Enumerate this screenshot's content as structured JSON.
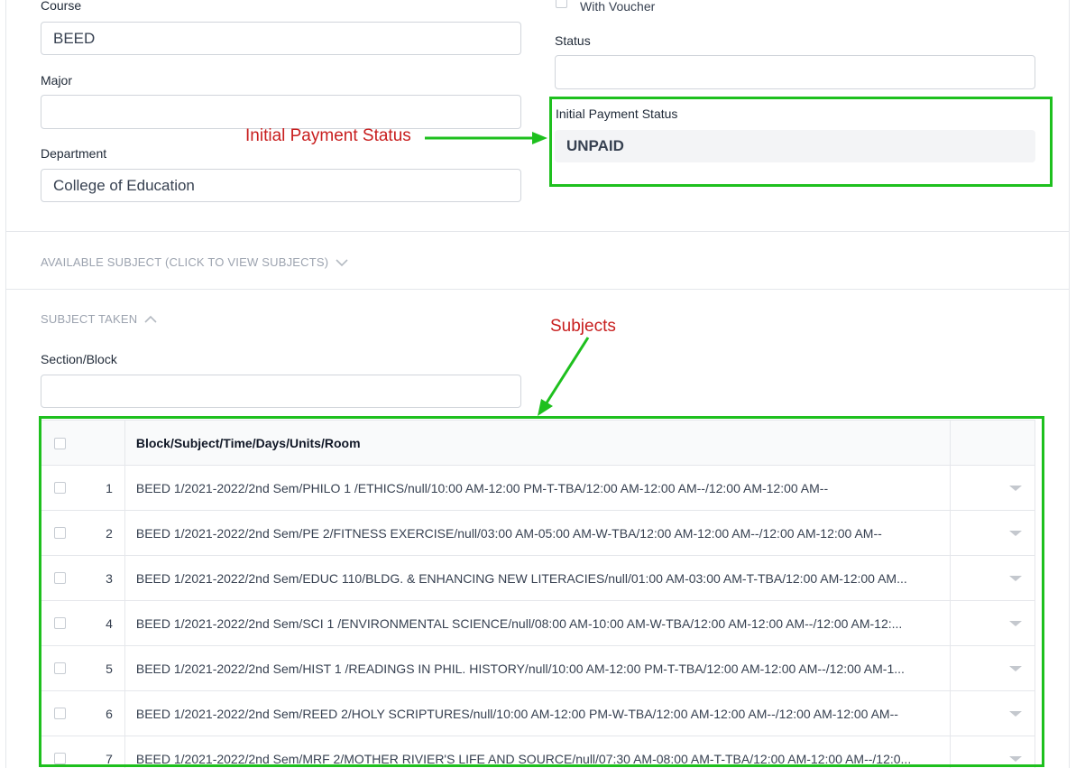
{
  "form": {
    "course_label": "Course",
    "course_value": "BEED",
    "major_label": "Major",
    "major_value": "",
    "department_label": "Department",
    "department_value": "College of Education",
    "with_voucher_label": "With Voucher",
    "status_label": "Status",
    "status_value": "",
    "initial_payment_label": "Initial Payment Status",
    "initial_payment_value": "UNPAID"
  },
  "sections": {
    "available_subject": "AVAILABLE SUBJECT (CLICK TO VIEW SUBJECTS)",
    "subject_taken": "SUBJECT TAKEN",
    "section_block_label": "Section/Block",
    "section_block_value": ""
  },
  "annotations": {
    "payment": "Initial Payment Status",
    "subjects": "Subjects"
  },
  "table": {
    "header": "Block/Subject/Time/Days/Units/Room",
    "rows": [
      {
        "num": "1",
        "text": "BEED 1/2021-2022/2nd Sem/PHILO 1 /ETHICS/null/10:00 AM-12:00 PM-T-TBA/12:00 AM-12:00 AM--/12:00 AM-12:00 AM--"
      },
      {
        "num": "2",
        "text": "BEED 1/2021-2022/2nd Sem/PE 2/FITNESS EXERCISE/null/03:00 AM-05:00 AM-W-TBA/12:00 AM-12:00 AM--/12:00 AM-12:00 AM--"
      },
      {
        "num": "3",
        "text": "BEED 1/2021-2022/2nd Sem/EDUC 110/BLDG. & ENHANCING NEW LITERACIES/null/01:00 AM-03:00 AM-T-TBA/12:00 AM-12:00 AM..."
      },
      {
        "num": "4",
        "text": "BEED 1/2021-2022/2nd Sem/SCI 1 /ENVIRONMENTAL SCIENCE/null/08:00 AM-10:00 AM-W-TBA/12:00 AM-12:00 AM--/12:00 AM-12:..."
      },
      {
        "num": "5",
        "text": "BEED 1/2021-2022/2nd Sem/HIST 1 /READINGS IN PHIL. HISTORY/null/10:00 AM-12:00 PM-T-TBA/12:00 AM-12:00 AM--/12:00 AM-1..."
      },
      {
        "num": "6",
        "text": "BEED 1/2021-2022/2nd Sem/REED 2/HOLY SCRIPTURES/null/10:00 AM-12:00 PM-W-TBA/12:00 AM-12:00 AM--/12:00 AM-12:00 AM--"
      },
      {
        "num": "7",
        "text": "BEED 1/2021-2022/2nd Sem/MRF 2/MOTHER RIVIER'S LIFE AND SOURCE/null/07:30 AM-08:00 AM-T-TBA/12:00 AM-12:00 AM--/12:0..."
      }
    ]
  },
  "colors": {
    "highlight": "#1ec01e",
    "annotation_text": "#c81e1e"
  }
}
